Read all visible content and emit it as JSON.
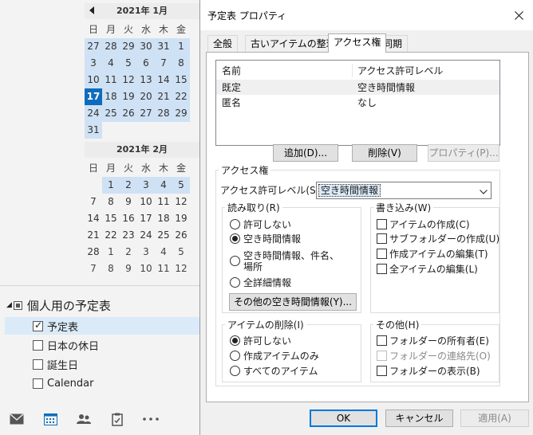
{
  "calendar": {
    "month1": {
      "title": "2021年 1月",
      "dow": [
        "日",
        "月",
        "火",
        "水",
        "木",
        "金"
      ],
      "weeks": [
        [
          "27",
          "28",
          "29",
          "30",
          "31",
          "1"
        ],
        [
          "3",
          "4",
          "5",
          "6",
          "7",
          "8"
        ],
        [
          "10",
          "11",
          "12",
          "13",
          "14",
          "15"
        ],
        [
          "17",
          "18",
          "19",
          "20",
          "21",
          "22"
        ],
        [
          "24",
          "25",
          "26",
          "27",
          "28",
          "29"
        ],
        [
          "31",
          "",
          "",
          "",
          "",
          ""
        ]
      ],
      "today": "17"
    },
    "month2": {
      "title": "2021年 2月",
      "dow": [
        "日",
        "月",
        "火",
        "水",
        "木",
        "金"
      ],
      "weeks": [
        [
          "",
          "1",
          "2",
          "3",
          "4",
          "5"
        ],
        [
          "7",
          "8",
          "9",
          "10",
          "11",
          "12"
        ],
        [
          "14",
          "15",
          "16",
          "17",
          "18",
          "19"
        ],
        [
          "21",
          "22",
          "23",
          "24",
          "25",
          "26"
        ],
        [
          "28",
          "1",
          "2",
          "3",
          "4",
          "5"
        ],
        [
          "7",
          "8",
          "9",
          "10",
          "11",
          "12"
        ]
      ]
    },
    "group_label": "個人用の予定表",
    "items": [
      {
        "label": "予定表",
        "checked": true
      },
      {
        "label": "日本の休日",
        "checked": false
      },
      {
        "label": "誕生日",
        "checked": false
      },
      {
        "label": "Calendar",
        "checked": false
      }
    ],
    "nav_icons": [
      "mail-icon",
      "calendar-icon",
      "people-icon",
      "tasks-icon",
      "more-icon"
    ]
  },
  "dialog": {
    "title": "予定表 プロパティ",
    "tabs": [
      "全般",
      "古いアイテムの整理",
      "アクセス権",
      "同期"
    ],
    "active_tab": "アクセス権",
    "list": {
      "col_name": "名前",
      "col_level": "アクセス許可レベル",
      "rows": [
        {
          "name": "既定",
          "level": "空き時間情報"
        },
        {
          "name": "匿名",
          "level": "なし"
        }
      ]
    },
    "buttons": {
      "add": "追加(D)...",
      "remove": "削除(V)",
      "properties": "プロパティ(P)..."
    },
    "permissions": {
      "title": "アクセス権",
      "level_label": "アクセス許可レベル(S):",
      "level_value": "空き時間情報",
      "read": {
        "title": "読み取り(R)",
        "options": [
          "許可しない",
          "空き時間情報",
          "空き時間情報、件名、",
          "場所",
          "全詳細情報"
        ],
        "selected": "空き時間情報",
        "more_button": "その他の空き時間情報(Y)..."
      },
      "write": {
        "title": "書き込み(W)",
        "options": [
          "アイテムの作成(C)",
          "サブフォルダーの作成(U)",
          "作成アイテムの編集(T)",
          "全アイテムの編集(L)"
        ]
      },
      "delete": {
        "title": "アイテムの削除(I)",
        "options": [
          "許可しない",
          "作成アイテムのみ",
          "すべてのアイテム"
        ],
        "selected": "許可しない"
      },
      "other": {
        "title": "その他(H)",
        "options": [
          "フォルダーの所有者(E)",
          "フォルダーの連絡先(O)",
          "フォルダーの表示(B)"
        ]
      }
    },
    "footer": {
      "ok": "OK",
      "cancel": "キャンセル",
      "apply": "適用(A)"
    }
  }
}
